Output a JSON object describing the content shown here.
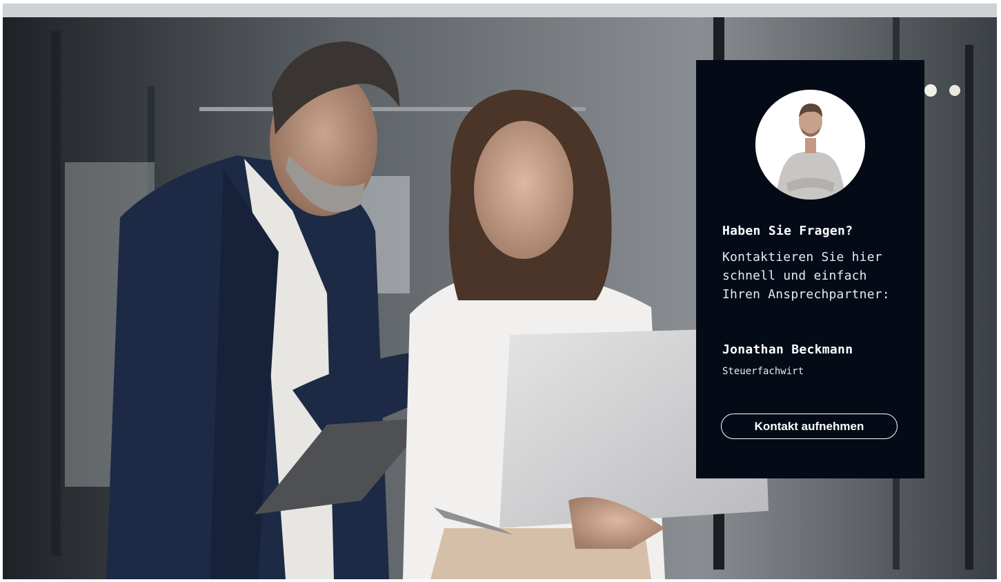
{
  "hero": {
    "image_description_icon": "office-team-photo"
  },
  "contact_card": {
    "avatar_icon": "person-avatar-icon",
    "title": "Haben Sie Fragen?",
    "text": "Kontaktieren Sie hier schnell und einfach Ihren Ansprechpartner:",
    "name": "Jonathan Beckmann",
    "role": "Steuerfachwirt",
    "button_label": "Kontakt aufnehmen"
  },
  "colors": {
    "card_background": "#050b16",
    "card_text": "#ffffff"
  }
}
